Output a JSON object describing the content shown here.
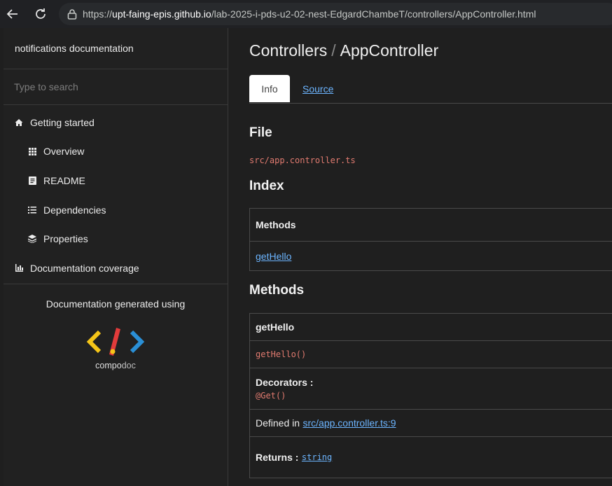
{
  "browser": {
    "url_prefix": "https://",
    "url_host": "upt-faing-epis.github.io",
    "url_path": "/lab-2025-i-pds-u2-02-nest-EdgardChambeT/controllers/AppController.html"
  },
  "sidebar": {
    "title": "notifications documentation",
    "search_placeholder": "Type to search",
    "items": [
      {
        "label": "Getting started",
        "icon": "home-icon"
      },
      {
        "label": "Overview",
        "icon": "grid-icon"
      },
      {
        "label": "README",
        "icon": "book-icon"
      },
      {
        "label": "Dependencies",
        "icon": "list-icon"
      },
      {
        "label": "Properties",
        "icon": "layers-icon"
      },
      {
        "label": "Documentation coverage",
        "icon": "bar-chart-icon"
      }
    ],
    "footer_text": "Documentation generated using",
    "logo_text_a": "compo",
    "logo_text_b": "doc"
  },
  "main": {
    "breadcrumb_root": "Controllers",
    "breadcrumb_sep": "/",
    "breadcrumb_current": "AppController",
    "tabs": [
      {
        "label": "Info"
      },
      {
        "label": "Source"
      }
    ],
    "file_heading": "File",
    "file_path": "src/app.controller.ts",
    "index_heading": "Index",
    "index_table": {
      "header": "Methods",
      "method_link": "getHello"
    },
    "methods_heading": "Methods",
    "method": {
      "name": "getHello",
      "signature": "getHello()",
      "decorators_label": "Decorators :",
      "decorator": "@Get()",
      "defined_in_label": "Defined in",
      "defined_in_link": "src/app.controller.ts:9",
      "returns_label": "Returns :",
      "returns_type": "string"
    }
  },
  "colors": {
    "link": "#6cb5ff",
    "code": "#e07a6f",
    "background": "#1f1f1f"
  }
}
